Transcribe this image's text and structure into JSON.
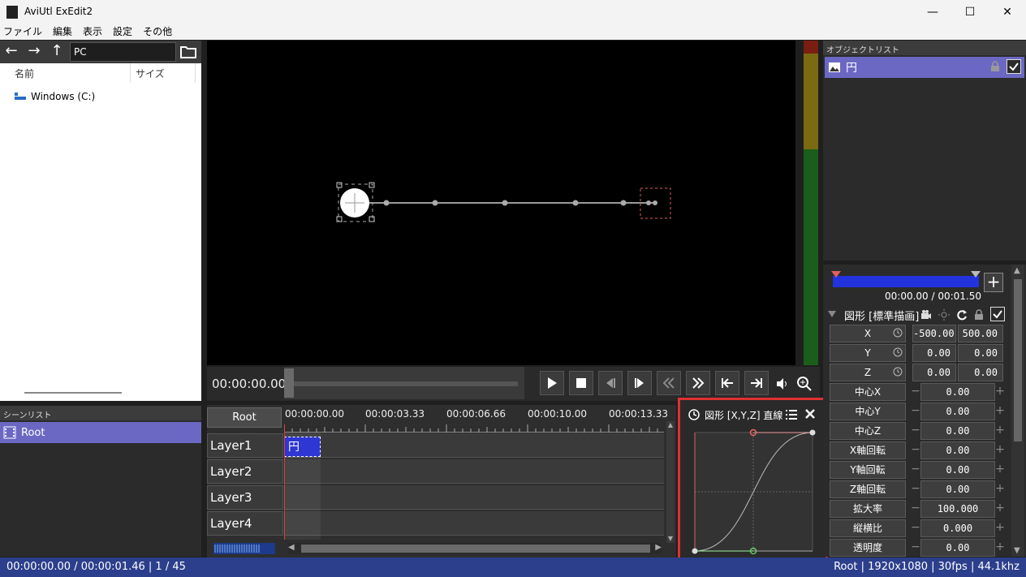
{
  "window": {
    "title": "AviUtl ExEdit2"
  },
  "menu": [
    "ファイル",
    "編集",
    "表示",
    "設定",
    "その他"
  ],
  "explorer": {
    "address": "PC",
    "col_name": "名前",
    "col_size": "サイズ",
    "items": [
      "Windows (C:)"
    ]
  },
  "scene_list": {
    "header": "シーンリスト",
    "items": [
      "Root"
    ]
  },
  "transport": {
    "time": "00:00:00.00"
  },
  "timeline": {
    "root_button": "Root",
    "ruler": [
      "00:00:00.00",
      "00:00:03.33",
      "00:00:06.66",
      "00:00:10.00",
      "00:00:13.33"
    ],
    "layers": [
      "Layer1",
      "Layer2",
      "Layer3",
      "Layer4"
    ],
    "object_label": "円"
  },
  "graph_panel": {
    "title": "図形 [X,Y,Z] 直線"
  },
  "object_list": {
    "header": "オブジェクトリスト",
    "items": [
      "円"
    ]
  },
  "properties": {
    "time_range": "00:00.00 / 00:01.50",
    "section_title": "図形 [標準描画]",
    "xyz": [
      {
        "label": "X",
        "start": "-500.00",
        "end": "500.00"
      },
      {
        "label": "Y",
        "start": "0.00",
        "end": "0.00"
      },
      {
        "label": "Z",
        "start": "0.00",
        "end": "0.00"
      }
    ],
    "rows": [
      {
        "label": "中心X",
        "value": "0.00"
      },
      {
        "label": "中心Y",
        "value": "0.00"
      },
      {
        "label": "中心Z",
        "value": "0.00"
      },
      {
        "label": "X軸回転",
        "value": "0.00"
      },
      {
        "label": "Y軸回転",
        "value": "0.00"
      },
      {
        "label": "Z軸回転",
        "value": "0.00"
      },
      {
        "label": "拡大率",
        "value": "100.000"
      },
      {
        "label": "縦横比",
        "value": "0.000"
      },
      {
        "label": "透明度",
        "value": "0.00"
      }
    ]
  },
  "status": {
    "left": "00:00:00.00 / 00:00:01.46 | 1 / 45",
    "right": "Root | 1920x1080 | 30fps | 44.1khz"
  },
  "colors": {
    "accent": "#6b68c4",
    "status_bar": "#2c3f8c",
    "object_clip": "#2e36d4",
    "highlight": "#e03030"
  }
}
